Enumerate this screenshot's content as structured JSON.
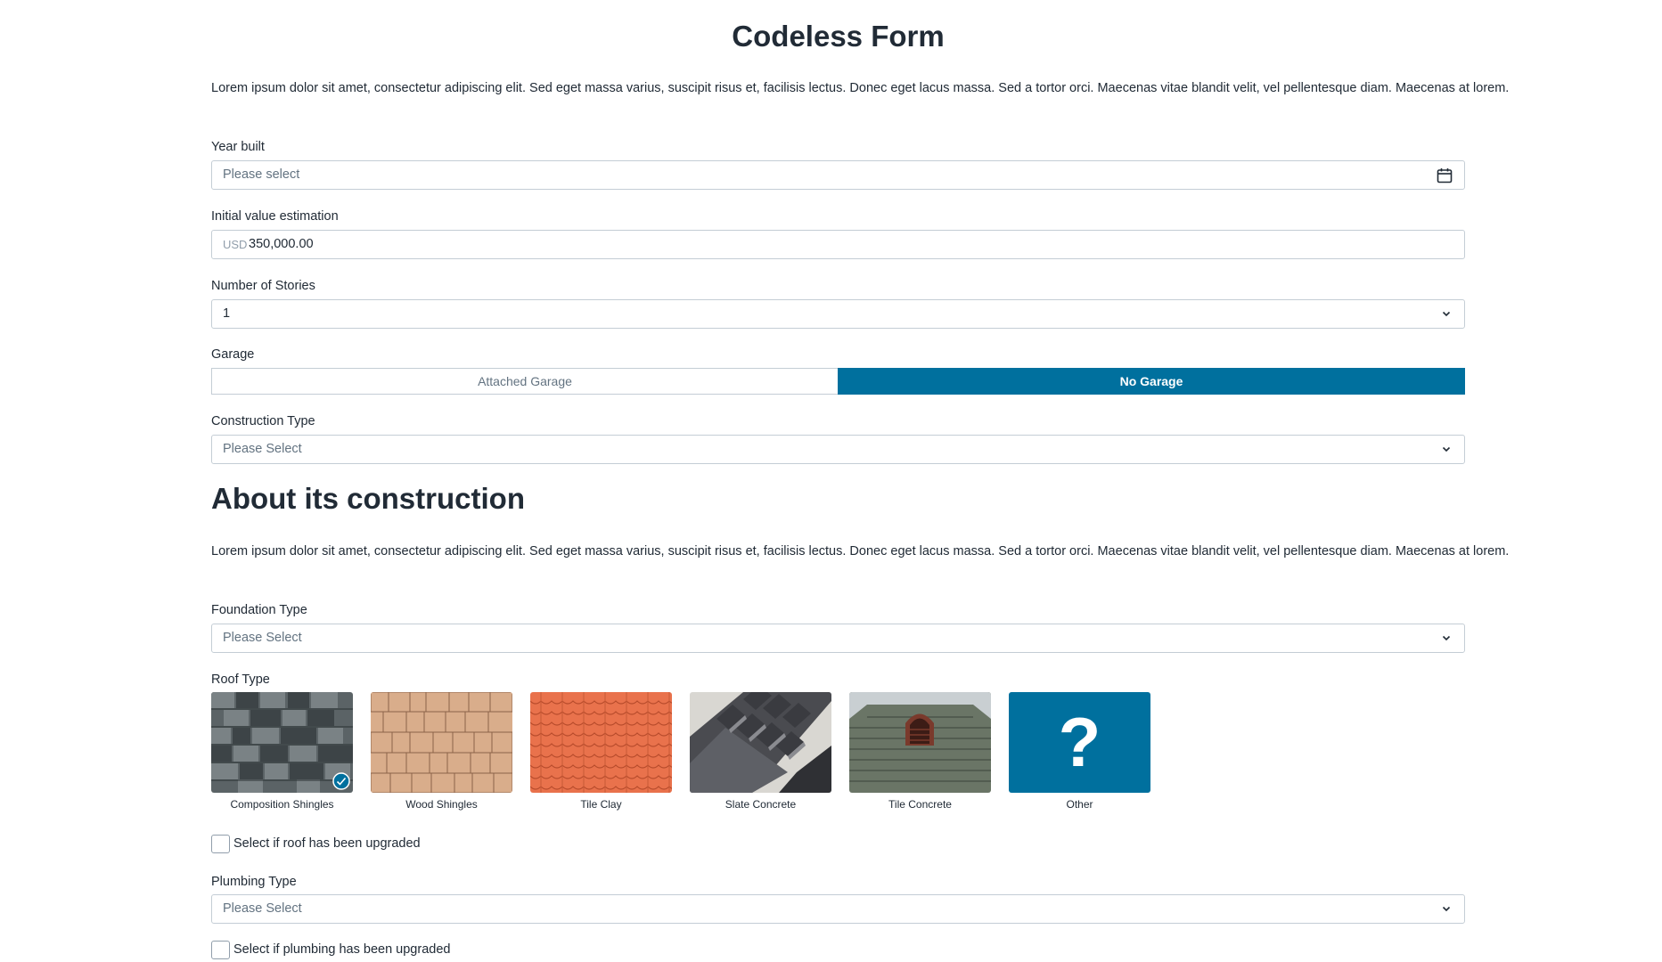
{
  "page": {
    "title": "Codeless Form",
    "intro": "Lorem ipsum dolor sit amet, consectetur adipiscing elit. Sed eget massa varius, suscipit risus et, facilisis lectus. Donec eget lacus massa. Sed a tortor orci. Maecenas vitae blandit velit, vel pellentesque diam. Maecenas at lorem."
  },
  "year_built": {
    "label": "Year built",
    "placeholder": "Please select"
  },
  "initial_value": {
    "label": "Initial value estimation",
    "currency": "USD",
    "value": "350,000.00"
  },
  "stories": {
    "label": "Number of Stories",
    "value": "1"
  },
  "garage": {
    "label": "Garage",
    "options": [
      "Attached Garage",
      "No Garage"
    ],
    "selected": "No Garage"
  },
  "construction_type": {
    "label": "Construction Type",
    "placeholder": "Please Select"
  },
  "section2": {
    "heading": "About its construction",
    "intro": "Lorem ipsum dolor sit amet, consectetur adipiscing elit. Sed eget massa varius, suscipit risus et, facilisis lectus. Donec eget lacus massa. Sed a tortor orci. Maecenas vitae blandit velit, vel pellentesque diam. Maecenas at lorem."
  },
  "foundation_type": {
    "label": "Foundation Type",
    "placeholder": "Please Select"
  },
  "roof_type": {
    "label": "Roof Type",
    "options": [
      "Composition Shingles",
      "Wood Shingles",
      "Tile Clay",
      "Slate Concrete",
      "Tile Concrete",
      "Other"
    ],
    "selected": "Composition Shingles",
    "other_glyph": "?"
  },
  "roof_upgraded": {
    "label": "Select if roof has been upgraded",
    "checked": false
  },
  "plumbing_type": {
    "label": "Plumbing Type",
    "placeholder": "Please Select"
  },
  "plumbing_upgraded": {
    "label": "Select if plumbing has been upgraded",
    "checked": false
  },
  "colors": {
    "accent": "#00709e",
    "border": "#c4cdd5",
    "text": "#212b36",
    "placeholder": "#637381"
  }
}
